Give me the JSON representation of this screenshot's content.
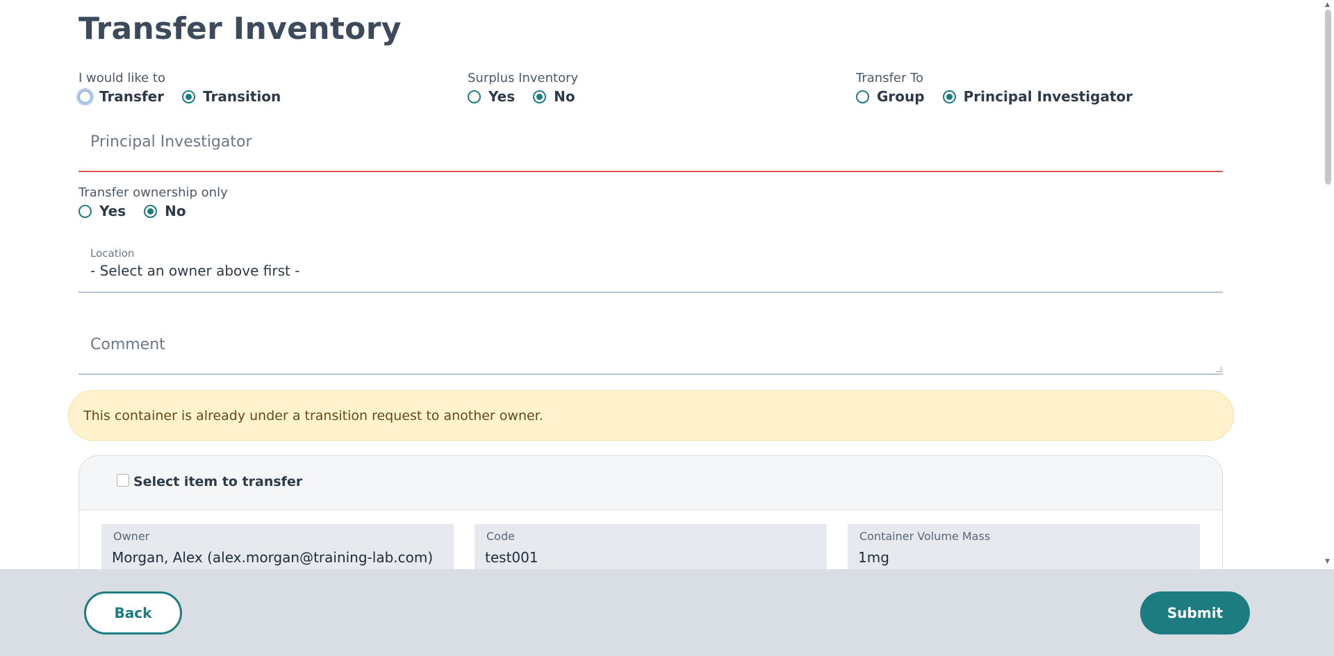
{
  "page": {
    "title": "Transfer Inventory"
  },
  "action": {
    "label": "I would like to",
    "options": [
      "Transfer",
      "Transition"
    ],
    "selected": "Transition"
  },
  "surplus": {
    "label": "Surplus Inventory",
    "options": [
      "Yes",
      "No"
    ],
    "selected": "No"
  },
  "transfer_to": {
    "label": "Transfer To",
    "options": [
      "Group",
      "Principal Investigator"
    ],
    "selected": "Principal Investigator"
  },
  "principal_investigator": {
    "placeholder": "Principal Investigator",
    "value": ""
  },
  "ownership_only": {
    "label": "Transfer ownership only",
    "options": [
      "Yes",
      "No"
    ],
    "selected": "No"
  },
  "location": {
    "label": "Location",
    "value": "- Select an owner above first -"
  },
  "comment": {
    "placeholder": "Comment",
    "value": ""
  },
  "alert": {
    "text": "This container is already under a transition request to another owner."
  },
  "item_card": {
    "select_label": "Select item to transfer",
    "checked": false,
    "fields": [
      {
        "label": "Owner",
        "value": "Morgan, Alex (alex.morgan@training-lab.com)"
      },
      {
        "label": "Code",
        "value": "test001"
      },
      {
        "label": "Container Volume Mass",
        "value": "1mg"
      }
    ]
  },
  "footer": {
    "back_label": "Back",
    "submit_label": "Submit"
  },
  "colors": {
    "accent": "#1c7c80",
    "error": "#d9534f",
    "alert_bg": "#fff2cd",
    "footer_bg": "#d9dee5"
  },
  "icons": {
    "scroll_up": "triangle-up-icon",
    "scroll_down": "triangle-down-icon",
    "resize": "resize-grip-icon"
  }
}
